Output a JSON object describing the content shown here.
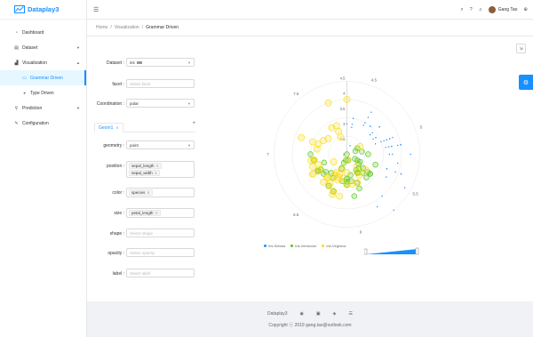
{
  "app": {
    "name": "Dataplay3"
  },
  "sidebar": {
    "items": [
      {
        "label": "Dashboard",
        "icon": "dashboard-icon",
        "glyph": "◔"
      },
      {
        "label": "Dataset",
        "icon": "table-icon",
        "glyph": "▤"
      },
      {
        "label": "Visualization",
        "icon": "chart-icon",
        "glyph": "▟"
      },
      {
        "label": "Grammar Driven",
        "icon": "area-chart-icon",
        "glyph": "▭"
      },
      {
        "label": "Type Driven",
        "icon": "pie-chart-icon",
        "glyph": "◕"
      },
      {
        "label": "Prediction",
        "icon": "bulb-icon",
        "glyph": "⚲"
      },
      {
        "label": "Configuration",
        "icon": "wrench-icon",
        "glyph": "✎"
      }
    ]
  },
  "header": {
    "user_name": "Gang Tao"
  },
  "breadcrumb": {
    "home": "Home",
    "section": "Visualization",
    "current": "Grammar Driven"
  },
  "form": {
    "dataset": {
      "label": "Dataset",
      "value": "iris"
    },
    "facet": {
      "label": "facet",
      "placeholder": "Select facet"
    },
    "coordination": {
      "label": "Coordination",
      "value": "polar"
    },
    "geom_tab": "Geom1",
    "geometry": {
      "label": "geometry",
      "value": "point"
    },
    "position": {
      "label": "position",
      "tags": [
        "sepal_length",
        "sepal_width"
      ]
    },
    "color": {
      "label": "color",
      "tags": [
        "species"
      ]
    },
    "size": {
      "label": "size",
      "tags": [
        "petal_length"
      ]
    },
    "shape": {
      "label": "shape",
      "placeholder": "Select shape"
    },
    "opacity": {
      "label": "opacity",
      "placeholder": "Select opacity"
    },
    "label": {
      "label": "label",
      "placeholder": "Select label"
    }
  },
  "chart_data": {
    "type": "scatter",
    "coordinate": "polar",
    "theta_ticks": [
      "4.5",
      "5",
      "5.5",
      "6",
      "6.5",
      "7",
      "7.5"
    ],
    "radius_ticks": [
      "2",
      "2.5",
      "3",
      "3.5",
      "4",
      "4.5"
    ],
    "legend": [
      {
        "name": "Iris-Setosa",
        "color": "#1890ff"
      },
      {
        "name": "Iris-Versicolor",
        "color": "#52c41a"
      },
      {
        "name": "Iris-Virginica",
        "color": "#fadb14"
      }
    ],
    "series": [
      {
        "name": "Iris-Setosa",
        "color": "#1890ff",
        "points": [
          [
            5.1,
            3.5
          ],
          [
            4.9,
            3.0
          ],
          [
            4.7,
            3.2
          ],
          [
            4.6,
            3.1
          ],
          [
            5.0,
            3.6
          ],
          [
            5.4,
            3.9
          ],
          [
            4.6,
            3.4
          ],
          [
            5.0,
            3.4
          ],
          [
            4.4,
            2.9
          ],
          [
            4.9,
            3.1
          ],
          [
            5.4,
            3.7
          ],
          [
            4.8,
            3.4
          ],
          [
            4.8,
            3.0
          ],
          [
            4.3,
            3.0
          ],
          [
            5.8,
            4.0
          ],
          [
            5.7,
            4.4
          ],
          [
            5.4,
            3.9
          ],
          [
            5.1,
            3.5
          ],
          [
            5.7,
            3.8
          ],
          [
            5.1,
            3.8
          ],
          [
            5.4,
            3.4
          ],
          [
            5.1,
            3.7
          ],
          [
            4.6,
            3.6
          ],
          [
            5.1,
            3.3
          ],
          [
            4.8,
            3.4
          ],
          [
            5.0,
            3.0
          ],
          [
            5.0,
            3.4
          ],
          [
            5.2,
            3.5
          ],
          [
            5.2,
            3.4
          ],
          [
            4.7,
            3.2
          ],
          [
            4.8,
            3.1
          ],
          [
            5.4,
            3.4
          ],
          [
            5.2,
            4.1
          ],
          [
            5.5,
            4.2
          ],
          [
            4.9,
            3.1
          ],
          [
            5.0,
            3.2
          ],
          [
            5.5,
            3.5
          ],
          [
            4.4,
            3.0
          ],
          [
            5.1,
            3.4
          ],
          [
            5.0,
            3.5
          ],
          [
            4.5,
            2.3
          ],
          [
            4.4,
            3.2
          ],
          [
            5.0,
            3.5
          ],
          [
            5.1,
            3.8
          ],
          [
            4.8,
            3.0
          ],
          [
            5.1,
            3.8
          ],
          [
            4.6,
            3.2
          ],
          [
            5.3,
            3.7
          ],
          [
            5.0,
            3.3
          ]
        ],
        "size": 1.4
      },
      {
        "name": "Iris-Versicolor",
        "color": "#52c41a",
        "points": [
          [
            7.0,
            3.2
          ],
          [
            6.4,
            3.2
          ],
          [
            6.9,
            3.1
          ],
          [
            5.5,
            2.3
          ],
          [
            6.5,
            2.8
          ],
          [
            5.7,
            2.8
          ],
          [
            6.3,
            3.3
          ],
          [
            4.9,
            2.4
          ],
          [
            6.6,
            2.9
          ],
          [
            5.2,
            2.7
          ],
          [
            5.0,
            2.0
          ],
          [
            5.9,
            3.0
          ],
          [
            6.0,
            2.2
          ],
          [
            6.1,
            2.9
          ],
          [
            5.6,
            2.9
          ],
          [
            6.7,
            3.1
          ],
          [
            5.6,
            3.0
          ],
          [
            5.8,
            2.7
          ],
          [
            6.2,
            2.2
          ],
          [
            5.6,
            2.5
          ],
          [
            5.9,
            3.2
          ],
          [
            6.1,
            2.8
          ],
          [
            6.3,
            2.5
          ],
          [
            6.1,
            2.8
          ],
          [
            6.4,
            2.9
          ],
          [
            6.6,
            3.0
          ],
          [
            6.8,
            2.8
          ],
          [
            6.7,
            3.0
          ],
          [
            6.0,
            2.9
          ],
          [
            5.7,
            2.6
          ],
          [
            5.5,
            2.4
          ],
          [
            5.8,
            2.7
          ],
          [
            6.0,
            2.7
          ],
          [
            5.4,
            3.0
          ],
          [
            6.0,
            3.4
          ],
          [
            6.7,
            3.1
          ],
          [
            6.3,
            2.3
          ],
          [
            5.6,
            3.0
          ],
          [
            5.5,
            2.5
          ],
          [
            6.1,
            3.0
          ],
          [
            5.8,
            2.6
          ],
          [
            5.0,
            2.3
          ],
          [
            5.6,
            2.7
          ],
          [
            5.7,
            3.0
          ],
          [
            6.2,
            2.9
          ],
          [
            5.1,
            2.5
          ]
        ],
        "size": 4.2
      },
      {
        "name": "Iris-Virginica",
        "color": "#fadb14",
        "points": [
          [
            6.3,
            3.3
          ],
          [
            5.8,
            2.7
          ],
          [
            7.1,
            3.0
          ],
          [
            6.3,
            2.9
          ],
          [
            6.5,
            3.0
          ],
          [
            7.6,
            3.0
          ],
          [
            4.9,
            2.5
          ],
          [
            7.3,
            2.9
          ],
          [
            6.7,
            2.5
          ],
          [
            7.2,
            3.6
          ],
          [
            6.5,
            3.2
          ],
          [
            6.4,
            2.7
          ],
          [
            6.8,
            3.0
          ],
          [
            5.7,
            2.5
          ],
          [
            5.8,
            2.8
          ],
          [
            6.4,
            3.2
          ],
          [
            6.5,
            3.0
          ],
          [
            7.7,
            3.8
          ],
          [
            7.7,
            2.6
          ],
          [
            6.0,
            2.2
          ],
          [
            6.9,
            3.2
          ],
          [
            5.6,
            2.8
          ],
          [
            7.7,
            2.8
          ],
          [
            6.3,
            2.7
          ],
          [
            6.7,
            3.3
          ],
          [
            7.2,
            3.2
          ],
          [
            6.2,
            2.8
          ],
          [
            6.1,
            3.0
          ],
          [
            6.4,
            2.8
          ],
          [
            7.2,
            3.0
          ],
          [
            7.4,
            2.8
          ],
          [
            7.9,
            3.8
          ],
          [
            6.4,
            2.8
          ],
          [
            6.3,
            2.8
          ],
          [
            6.1,
            2.6
          ],
          [
            7.7,
            3.0
          ],
          [
            6.3,
            3.4
          ],
          [
            6.4,
            3.1
          ],
          [
            6.0,
            3.0
          ],
          [
            6.9,
            3.1
          ],
          [
            6.7,
            3.1
          ],
          [
            6.9,
            3.1
          ],
          [
            6.8,
            3.2
          ],
          [
            6.7,
            3.3
          ],
          [
            6.7,
            3.0
          ],
          [
            6.3,
            2.5
          ],
          [
            6.5,
            3.0
          ],
          [
            6.2,
            3.4
          ],
          [
            5.9,
            3.0
          ]
        ],
        "size": 5.6
      }
    ]
  },
  "footer": {
    "brand": "Dataplay3",
    "icons": [
      "github-icon",
      "book-icon",
      "image-icon",
      "read-icon"
    ],
    "copyright": "Copyright ⓒ 2019 gang.tao@outlook.com"
  }
}
